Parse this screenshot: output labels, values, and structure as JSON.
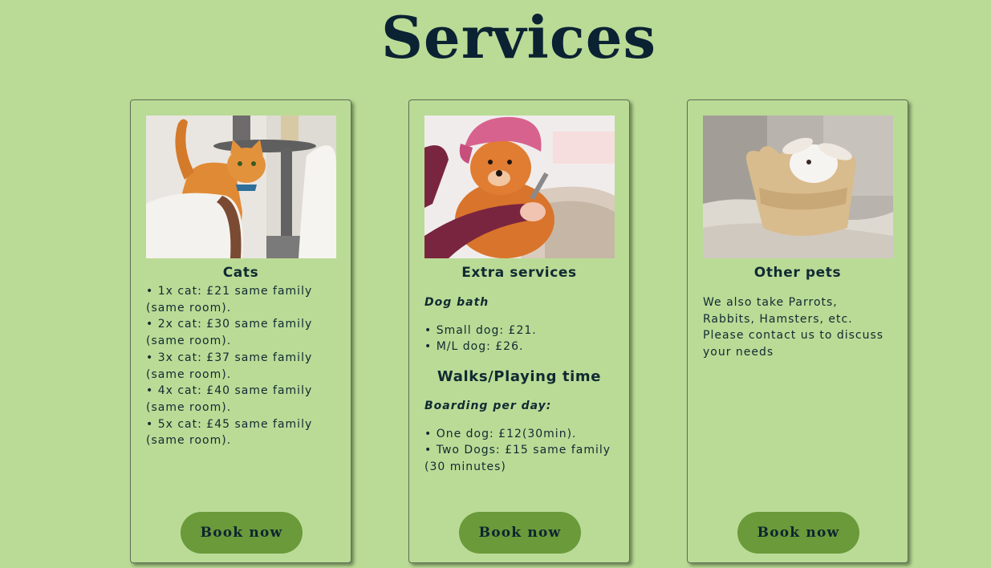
{
  "page": {
    "title": "Services"
  },
  "cards": [
    {
      "title": "Cats",
      "lines": [
        "• 1x cat: £21 same family (same room).",
        "• 2x cat: £30 same family (same room).",
        "• 3x cat: £37 same family (same room).",
        "• 4x cat: £40 same family (same room).",
        "• 5x cat: £45 same family (same room)."
      ],
      "button": "Book now"
    },
    {
      "title": "Extra services",
      "dog_bath": {
        "subtitle": "Dog bath",
        "lines": [
          "• Small dog: £21.",
          "• M/L dog: £26."
        ]
      },
      "walks": {
        "title": "Walks/Playing time",
        "subtitle": "Boarding per day:",
        "lines": [
          "• One dog: £12(30min).",
          "• Two Dogs: £15 same family (30 minutes)"
        ]
      },
      "button": "Book now"
    },
    {
      "title": "Other pets",
      "text": "We also take Parrots, Rabbits, Hamsters, etc. Please contact us to discuss your needs",
      "button": "Book now"
    }
  ],
  "colors": {
    "background": "#badb96",
    "button": "#6a9a3a",
    "text": "#102a32"
  }
}
